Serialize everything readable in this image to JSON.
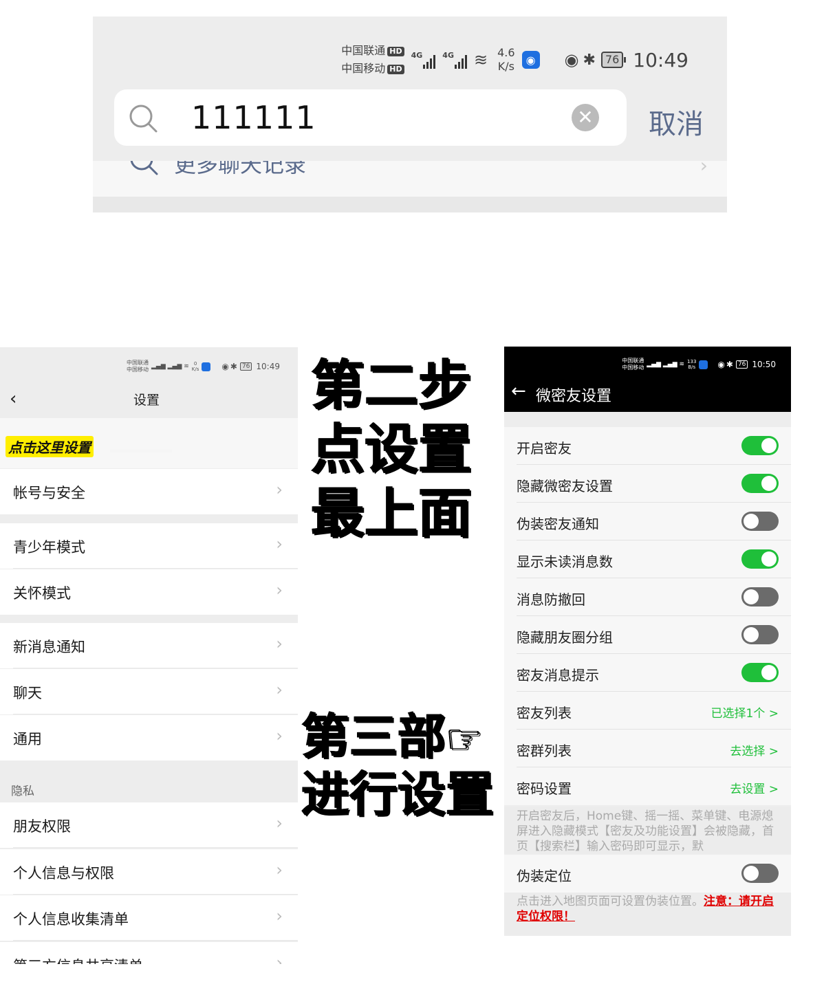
{
  "top_screenshot": {
    "status_bar": {
      "carrier1": "中国联通",
      "carrier2": "中国移动",
      "hd": "HD",
      "signal_label": "4G",
      "speed_value": "4.6",
      "speed_unit": "K/s",
      "battery": "76",
      "time": "10:49"
    },
    "search": {
      "value": "111111",
      "clear_icon": "clear-icon",
      "search_icon": "search-icon"
    },
    "cancel_label": "取消",
    "more_history": "更多聊天记录"
  },
  "left_screenshot": {
    "status_bar": {
      "carrier1": "中国联通",
      "carrier2": "中国移动",
      "speed_value": "0",
      "speed_unit": "K/s",
      "battery": "76",
      "time": "10:49"
    },
    "nav_title": "设置",
    "highlight_note": "点击这里设置",
    "rows": [
      {
        "label": "帐号与安全"
      },
      {
        "label": "青少年模式"
      },
      {
        "label": "关怀模式"
      },
      {
        "label": "新消息通知"
      },
      {
        "label": "聊天"
      },
      {
        "label": "通用"
      },
      {
        "label": "朋友权限"
      },
      {
        "label": "个人信息与权限"
      },
      {
        "label": "个人信息收集清单"
      },
      {
        "label": "第三方信息共享清单"
      }
    ],
    "section_privacy": "隐私"
  },
  "middle_text": {
    "step2": [
      "第二步",
      "点设置",
      "最上面"
    ],
    "step3": [
      "第三部",
      "进行设置"
    ],
    "pointer": "☞"
  },
  "right_screenshot": {
    "status_bar": {
      "carrier1": "中国联通",
      "carrier2": "中国移动",
      "speed_value": "133",
      "speed_unit": "B/s",
      "battery": "76",
      "time": "10:50"
    },
    "title": "微密友设置",
    "rows": [
      {
        "label": "开启密友",
        "toggle": "on"
      },
      {
        "label": "隐藏微密友设置",
        "toggle": "on"
      },
      {
        "label": "伪装密友通知",
        "toggle": "off"
      },
      {
        "label": "显示未读消息数",
        "toggle": "on"
      },
      {
        "label": "消息防撤回",
        "toggle": "off"
      },
      {
        "label": "隐藏朋友圈分组",
        "toggle": "off"
      },
      {
        "label": "密友消息提示",
        "toggle": "on"
      },
      {
        "label": "密友列表",
        "value": "已选择1个 >"
      },
      {
        "label": "密群列表",
        "value": "去选择 >"
      },
      {
        "label": "密码设置",
        "value": "去设置 >"
      }
    ],
    "note1": "开启密友后，Home键、摇一摇、菜单键、电源熄屏进入隐藏模式【密友及功能设置】会被隐藏，首页【搜索栏】输入密码即可显示，默",
    "fake_location_label": "伪装定位",
    "fake_location_toggle": "off",
    "note2_prefix": "点击进入地图页面可设置伪装位置。",
    "note2_warning": "注意：请开启定位权限！",
    "colors": {
      "toggle_on": "#1fbf3a",
      "warning": "#e00000",
      "highlight": "#ffee00"
    }
  }
}
